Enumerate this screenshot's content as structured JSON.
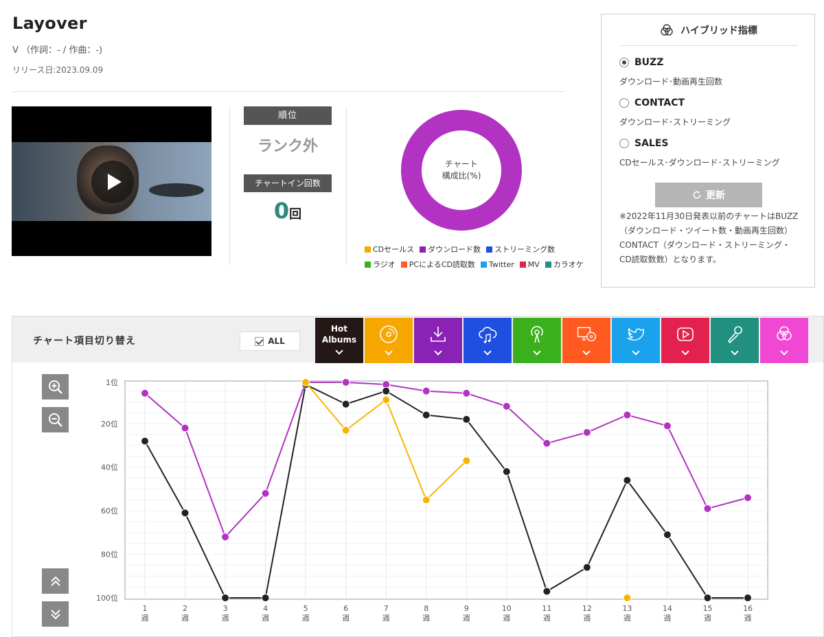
{
  "song": {
    "title": "Layover",
    "credits": "V （作詞：- / 作曲：-)",
    "release": "リリース日:2023.09.09"
  },
  "rank": {
    "label": "順位",
    "value": "ランク外",
    "chartin_label": "チャートイン回数",
    "chartin_count": "0",
    "chartin_unit": "回"
  },
  "composition": {
    "label_line1": "チャート",
    "label_line2": "構成比(%)",
    "donut_color": "#b232c2",
    "legend": [
      {
        "label": "CDセールス",
        "color": "#f7a800"
      },
      {
        "label": "ダウンロード数",
        "color": "#8a22b5"
      },
      {
        "label": "ストリーミング数",
        "color": "#1f4fe0"
      },
      {
        "label": "ラジオ",
        "color": "#3ab01c"
      },
      {
        "label": "PCによるCD読取数",
        "color": "#ff5a1f"
      },
      {
        "label": "Twitter",
        "color": "#1aa2ec"
      },
      {
        "label": "MV",
        "color": "#e3214f"
      },
      {
        "label": "カラオケ",
        "color": "#229080"
      }
    ]
  },
  "hybrid": {
    "title": "ハイブリッド指標",
    "options": [
      {
        "label": "BUZZ",
        "desc": "ダウンロード･動画再生回数",
        "selected": true
      },
      {
        "label": "CONTACT",
        "desc": "ダウンロード･ストリーミング",
        "selected": false
      },
      {
        "label": "SALES",
        "desc": "CDセールス･ダウンロード･ストリーミング",
        "selected": false
      }
    ],
    "update_label": "更新",
    "note": "※2022年11月30日発表以前のチャートはBUZZ（ダウンロード・ツイート数・動画再生回数）CONTACT（ダウンロード・ストリーミング・CD読取数数）となります。"
  },
  "switcher": {
    "label": "チャート項目切り替え",
    "all_label": "ALL",
    "hot_label_1": "Hot",
    "hot_label_2": "Albums",
    "categories": [
      {
        "name": "hot-albums",
        "color": "#231815",
        "icon": "text"
      },
      {
        "name": "cd-sales",
        "color": "#f7a800",
        "icon": "disc-icon"
      },
      {
        "name": "download",
        "color": "#8a22b5",
        "icon": "download-icon"
      },
      {
        "name": "streaming",
        "color": "#1f4fe0",
        "icon": "cloud-music-icon"
      },
      {
        "name": "radio",
        "color": "#3ab01c",
        "icon": "radio-icon"
      },
      {
        "name": "pc-cd-read",
        "color": "#ff5a1f",
        "icon": "pc-disc-icon"
      },
      {
        "name": "twitter",
        "color": "#1aa2ec",
        "icon": "twitter-icon"
      },
      {
        "name": "mv",
        "color": "#e3214f",
        "icon": "play-icon"
      },
      {
        "name": "karaoke",
        "color": "#229080",
        "icon": "mic-icon"
      },
      {
        "name": "hybrid",
        "color": "#f048d2",
        "icon": "hybrid-icon"
      }
    ]
  },
  "chart_data": {
    "type": "line",
    "x": [
      1,
      2,
      3,
      4,
      5,
      6,
      7,
      8,
      9,
      10,
      11,
      12,
      13,
      14,
      15,
      16
    ],
    "x_tick_labels": [
      "1\n週",
      "2\n週",
      "3\n週",
      "4\n週",
      "5\n週",
      "6\n週",
      "7\n週",
      "8\n週",
      "9\n週",
      "10\n週",
      "11\n週",
      "12\n週",
      "13\n週",
      "14\n週",
      "15\n週",
      "16\n週"
    ],
    "y_tick_labels": [
      "1位",
      "20位",
      "40位",
      "60位",
      "80位",
      "100位"
    ],
    "y_ticks": [
      1,
      20,
      40,
      60,
      80,
      100
    ],
    "ylim": [
      1,
      100
    ],
    "y_inverted": true,
    "grid": true,
    "series": [
      {
        "color": "#b232c2",
        "values": [
          6,
          22,
          72,
          52,
          1,
          1,
          2,
          5,
          6,
          12,
          29,
          24,
          16,
          21,
          59,
          54
        ]
      },
      {
        "color": "#222222",
        "values": [
          28,
          61,
          100,
          100,
          2,
          11,
          5,
          16,
          18,
          42,
          97,
          86,
          46,
          71,
          100,
          100
        ]
      },
      {
        "color": "#f7b500",
        "values": [
          null,
          null,
          null,
          null,
          1,
          23,
          9,
          55,
          37,
          null,
          null,
          null,
          100,
          null,
          null,
          null
        ]
      }
    ]
  }
}
